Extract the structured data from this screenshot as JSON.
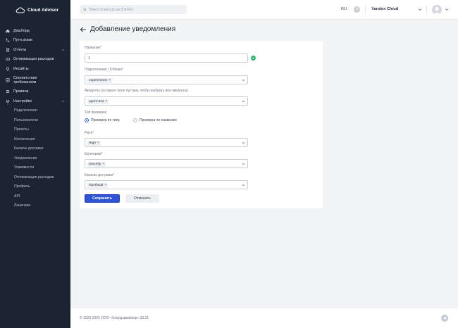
{
  "app": {
    "name": "Cloud Advisor"
  },
  "sidebar": {
    "items": [
      {
        "label": "Дашборд",
        "icon": "home-icon"
      },
      {
        "label": "Пути атаки",
        "icon": "route-icon"
      },
      {
        "label": "Отчеты",
        "icon": "report-icon"
      },
      {
        "label": "Оптимизация расходов",
        "icon": "money-icon"
      },
      {
        "label": "Инсайты",
        "icon": "lightbulb-icon"
      },
      {
        "label": "Соответствие требованиям",
        "icon": "compliance-icon"
      },
      {
        "label": "Правила",
        "icon": "list-icon"
      },
      {
        "label": "Настройки",
        "icon": "gear-icon"
      }
    ],
    "settings_sub": [
      "Подключения",
      "Пользователи",
      "Проекты",
      "Исключения",
      "Каналы доставки",
      "Уведомления",
      "Уязвимости",
      "Оптимизация расходов",
      "Профиль",
      "API",
      "Лицензии"
    ]
  },
  "header": {
    "search_placeholder": "Поиск по ресурсам (Ctrl+K)",
    "lang": "RU",
    "help": "?",
    "cloud": "Yandex Cloud"
  },
  "page": {
    "title": "Добавление уведомления"
  },
  "form": {
    "name_label": "Название*",
    "name_value": "1",
    "connections_label": "Подключения / Облака*",
    "connections_chip": "experiments",
    "accounts_label": "Аккаунты (оставьте поле пустым, чтобы выбрать все аккаунты)",
    "accounts_chip": "agent-test",
    "check_type_label": "Тип проверки",
    "radio_by_type": "Проверка по типу",
    "radio_by_name": "Проверка по названию",
    "risk_label": "Риск*",
    "risk_chip": "High",
    "category_label": "Категории*",
    "category_chip": "Security",
    "channels_label": "Каналы доставки*",
    "channels_chip": "Пробный",
    "save": "Сохранить",
    "cancel": "Отменить"
  },
  "footer": {
    "copyright": "© 2020-2025 ООО «Клаудэдвайзор» 33.21"
  },
  "colors": {
    "sidebar": "#1b2433",
    "primary": "#2f55d4",
    "success": "#27b36b"
  }
}
